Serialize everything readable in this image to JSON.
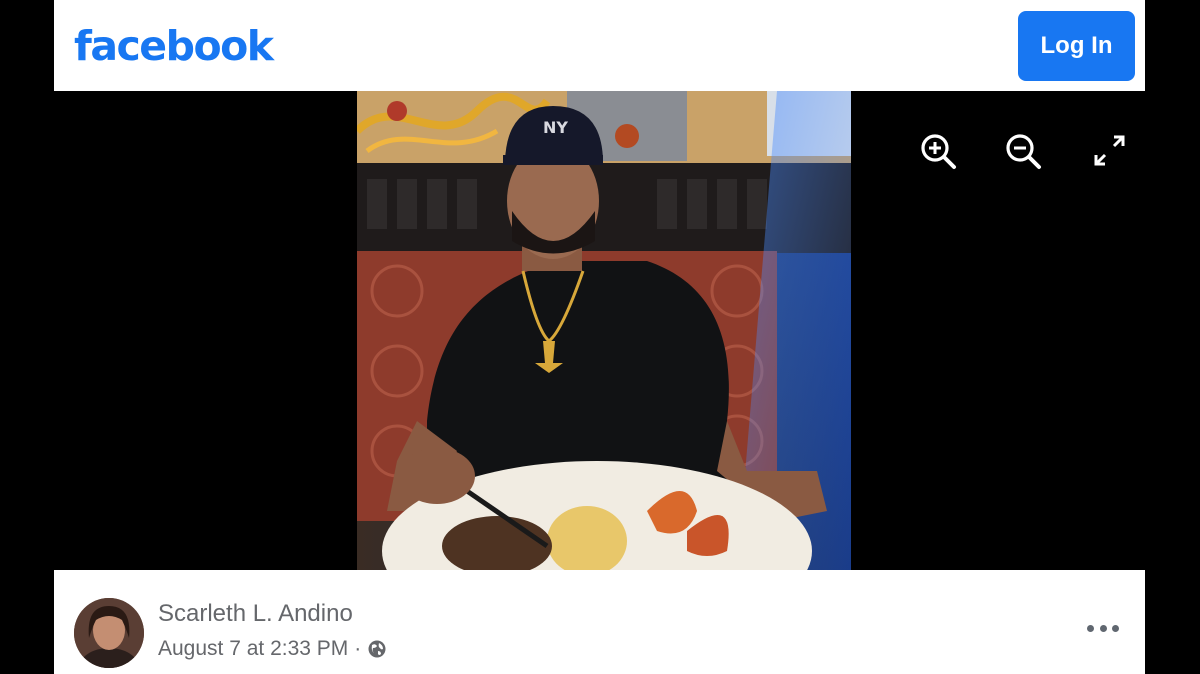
{
  "header": {
    "logo_text": "facebook",
    "login_label": "Log In",
    "brand_color": "#1877f2"
  },
  "viewer": {
    "controls": [
      {
        "icon": "zoom-in-icon"
      },
      {
        "icon": "zoom-out-icon"
      },
      {
        "icon": "fullscreen-icon"
      }
    ]
  },
  "post": {
    "author": "Scarleth L. Andino",
    "date": "August 7 at 2:33 PM",
    "separator": "·",
    "privacy_icon": "globe-icon",
    "more_icon": "more-options-icon"
  }
}
